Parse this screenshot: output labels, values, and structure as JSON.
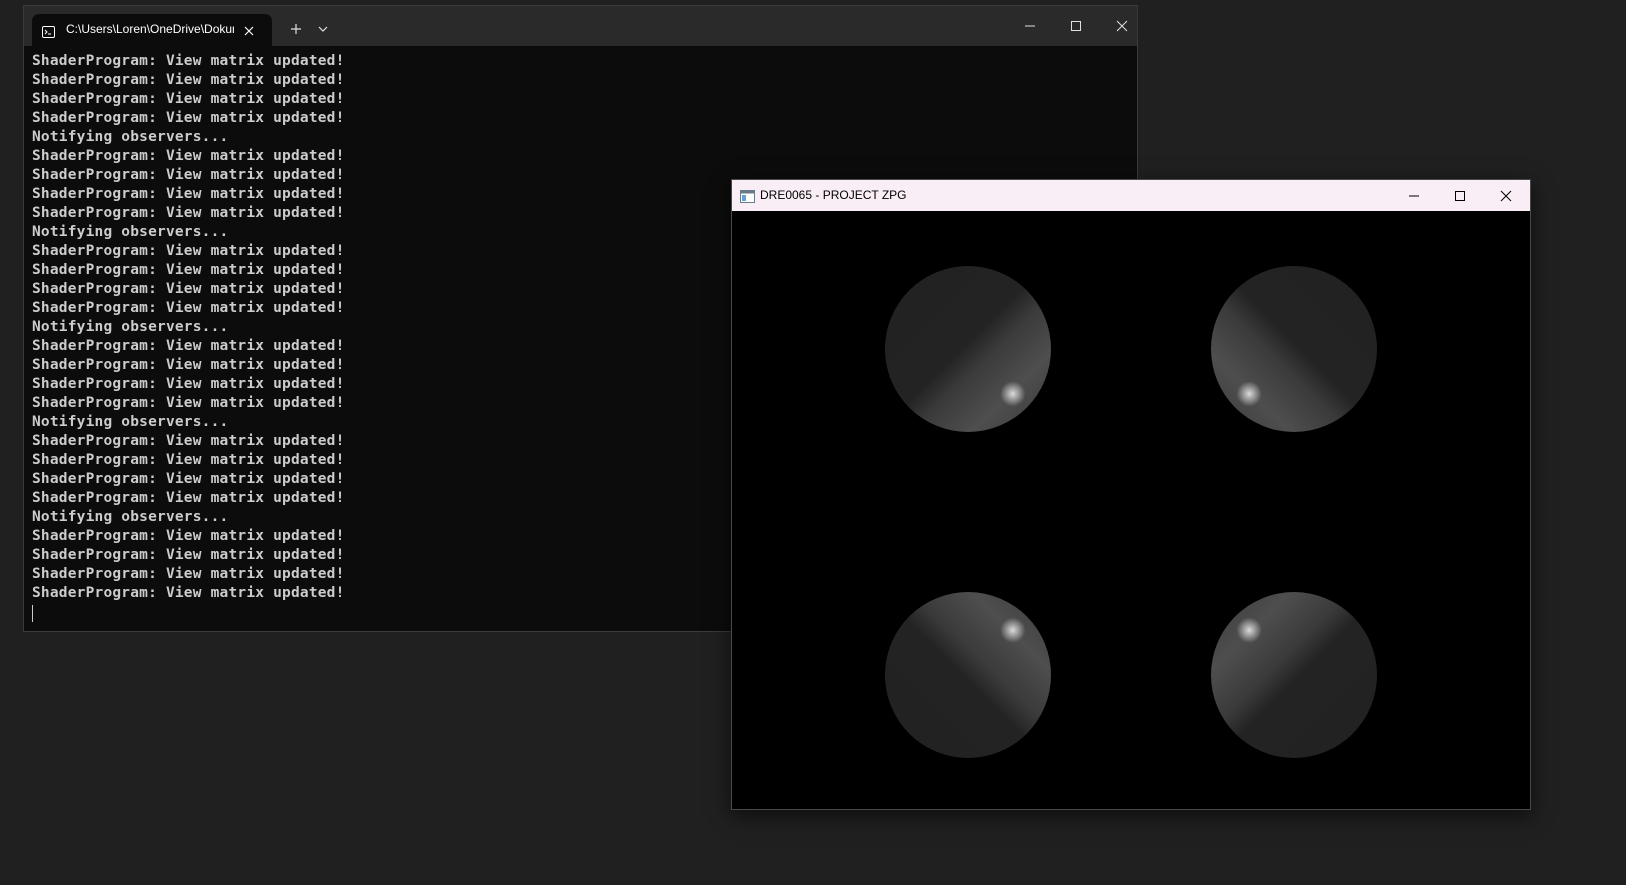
{
  "terminal": {
    "tab_title": "C:\\Users\\Loren\\OneDrive\\Dokumenty",
    "tab_icon": "terminal-app-icon",
    "lines": [
      "ShaderProgram: View matrix updated!",
      "ShaderProgram: View matrix updated!",
      "ShaderProgram: View matrix updated!",
      "ShaderProgram: View matrix updated!",
      "Notifying observers...",
      "ShaderProgram: View matrix updated!",
      "ShaderProgram: View matrix updated!",
      "ShaderProgram: View matrix updated!",
      "ShaderProgram: View matrix updated!",
      "Notifying observers...",
      "ShaderProgram: View matrix updated!",
      "ShaderProgram: View matrix updated!",
      "ShaderProgram: View matrix updated!",
      "ShaderProgram: View matrix updated!",
      "Notifying observers...",
      "ShaderProgram: View matrix updated!",
      "ShaderProgram: View matrix updated!",
      "ShaderProgram: View matrix updated!",
      "ShaderProgram: View matrix updated!",
      "Notifying observers...",
      "ShaderProgram: View matrix updated!",
      "ShaderProgram: View matrix updated!",
      "ShaderProgram: View matrix updated!",
      "ShaderProgram: View matrix updated!",
      "Notifying observers...",
      "ShaderProgram: View matrix updated!",
      "ShaderProgram: View matrix updated!",
      "ShaderProgram: View matrix updated!",
      "ShaderProgram: View matrix updated!"
    ],
    "colors": {
      "background": "#0c0c0c",
      "titlebar": "#2a2a2a",
      "text": "#cccccc"
    }
  },
  "gl_window": {
    "title": "DRE0065 - PROJECT ZPG",
    "app_icon": "window-app-icon",
    "scene": {
      "objects": [
        "sphere",
        "sphere",
        "sphere",
        "sphere"
      ],
      "background_color": "#000000"
    },
    "colors": {
      "titlebar": "#f9eef5"
    }
  },
  "desktop": {
    "background_color": "#202020"
  }
}
